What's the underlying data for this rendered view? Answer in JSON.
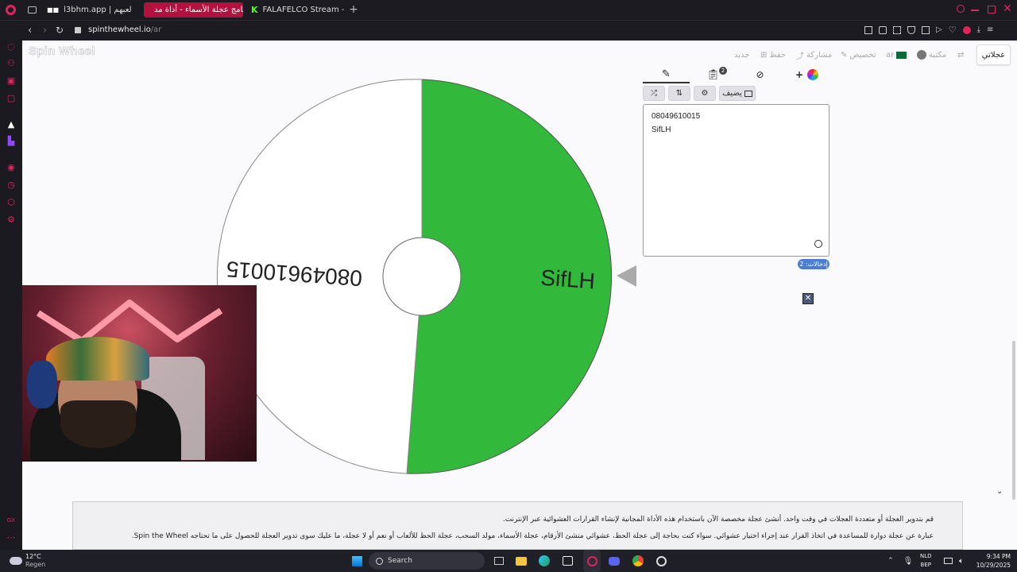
{
  "browser": {
    "tabs": [
      {
        "title": "l3bhm.app | لعبهم",
        "active": false
      },
      {
        "title": "برنامج عجلة الأسماء - أداة مد...",
        "active": true
      },
      {
        "title": "FALAFELCO Stream - Wat",
        "active": false
      }
    ],
    "url_host": "spinthewheel.io",
    "url_path": "/ar"
  },
  "site": {
    "logo": "Spin Wheel",
    "toolbar": {
      "my_wheels": "عجلاتي",
      "gallery": "مكتبة",
      "lang": "ar",
      "customize": "تخصيص",
      "share": "مشاركة",
      "save": "حفظ",
      "new": "جديد"
    }
  },
  "wheel": {
    "segments": [
      {
        "label": "SifLH",
        "color": "#32b83a"
      },
      {
        "label": "08049610015",
        "color": "#ffffff"
      }
    ]
  },
  "editor": {
    "add_image_label": "يضيف",
    "entries": [
      "08049610015",
      "SifLH"
    ],
    "entries_count_label": "إدخالات: 2",
    "tab_badge": "2"
  },
  "description": {
    "line1": "قم بتدوير العجلة أو متعددة العجلات في وقت واحد. أنشئ عجلة مخصصة الآن باستخدام هذه الأداة المجانية لإنشاء القرارات العشوائية عبر الإنترنت.",
    "line2": "عبارة عن عجلة دوارة للمساعدة في اتخاذ القرار عند إجراء اختيار عشوائي. سواء كنت بحاجة إلى عجلة الحظ، عشوائي منشئ الأرقام، عجلة الأسماء، مولد السحب، عجلة الحظ للألعاب أو نعم أو لا عجلة، ما عليك سوى تدوير العجلة للحصول على ما تحتاجه Spin the Wheel."
  },
  "taskbar": {
    "weather_temp": "12°C",
    "weather_desc": "Regen",
    "search": "Search",
    "lang1": "NLD",
    "lang2": "BEP",
    "time": "9:34 PM",
    "date": "10/29/2025"
  }
}
